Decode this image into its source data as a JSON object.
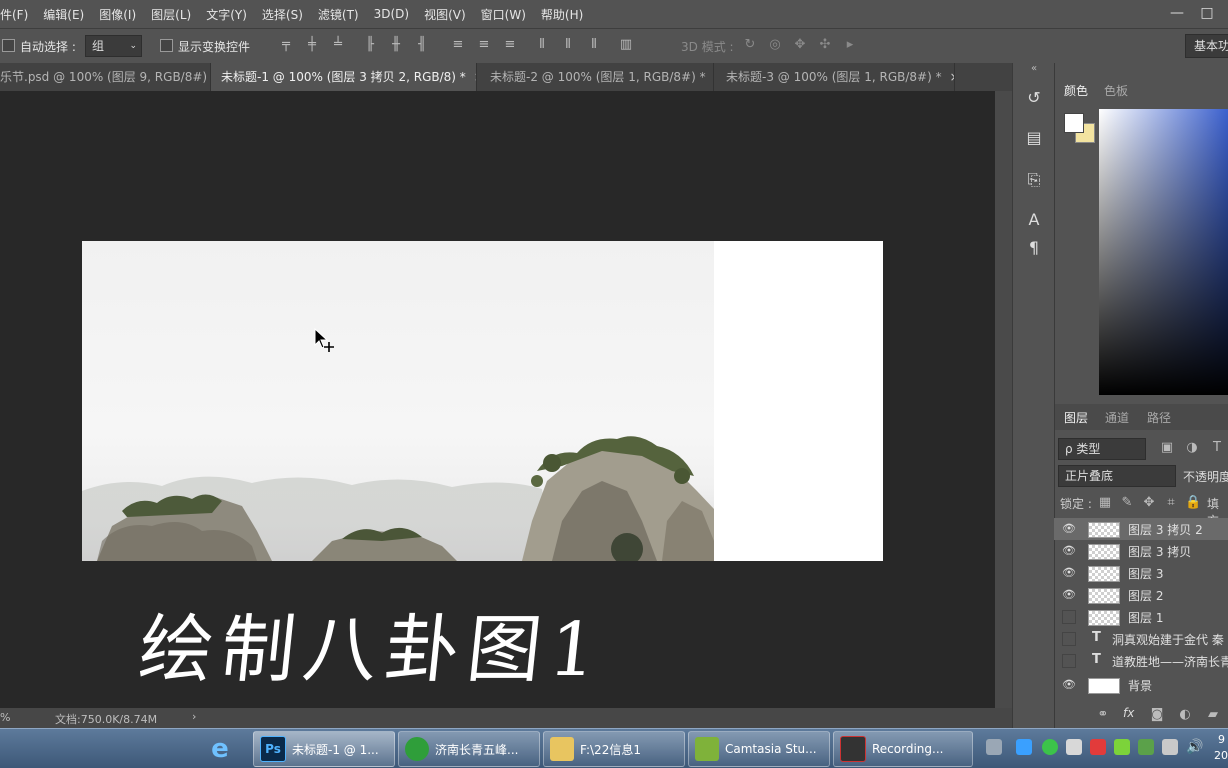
{
  "menu": [
    "件(F)",
    "编辑(E)",
    "图像(I)",
    "图层(L)",
    "文字(Y)",
    "选择(S)",
    "滤镜(T)",
    "3D(D)",
    "视图(V)",
    "窗口(W)",
    "帮助(H)"
  ],
  "window_controls": [
    "—",
    "□"
  ],
  "options": {
    "auto_select_label": "自动选择 :",
    "auto_select_value": "组",
    "show_transform_label": "显示变换控件",
    "mode3d_label": "3D 模式 :",
    "workspace": "基本功"
  },
  "tabs": [
    {
      "label": "乐节.psd @ 100% (图层 9, RGB/8#)",
      "close": "×"
    },
    {
      "label": "未标题-1 @ 100% (图层 3 拷贝 2, RGB/8) *",
      "close": "×"
    },
    {
      "label": "未标题-2 @ 100% (图层 1, RGB/8#) *",
      "close": "×"
    },
    {
      "label": "未标题-3 @ 100% (图层 1, RGB/8#) *",
      "close": "×"
    }
  ],
  "status": {
    "zoom": "%",
    "doc_info": "文档:750.0K/8.74M",
    "arrow": "›"
  },
  "caption": "绘制八卦图1",
  "color_panel": {
    "tabs": [
      "颜色",
      "色板"
    ]
  },
  "layers_panel": {
    "tabs": [
      "图层",
      "通道",
      "路径"
    ],
    "filter_kind": "ρ 类型",
    "blend_mode": "正片叠底",
    "opacity_label": "不透明度",
    "lock_label": "锁定 :",
    "fill_label": "填充",
    "layers": [
      {
        "name": "图层 3 拷贝 2",
        "kind": "pixel",
        "visible": true,
        "selected": true
      },
      {
        "name": "图层 3 拷贝",
        "kind": "pixel",
        "visible": true,
        "selected": false
      },
      {
        "name": "图层 3",
        "kind": "pixel",
        "visible": true,
        "selected": false
      },
      {
        "name": "图层 2",
        "kind": "pixel",
        "visible": true,
        "selected": false
      },
      {
        "name": "图层 1",
        "kind": "pixel",
        "visible": false,
        "selected": false
      },
      {
        "name": "洞真观始建于金代 秦",
        "kind": "text",
        "visible": false,
        "selected": false
      },
      {
        "name": "道教胜地——济南长青",
        "kind": "text",
        "visible": false,
        "selected": false
      },
      {
        "name": "背景",
        "kind": "white",
        "visible": true,
        "selected": false
      }
    ],
    "footer_fx": "fx"
  },
  "taskbar": {
    "items": [
      {
        "label": "未标题-1 @ 1...",
        "icon": "Ps"
      },
      {
        "label": "济南长青五峰...",
        "icon": "browser-icon"
      },
      {
        "label": "F:\\22信息1",
        "icon": "folder-icon"
      },
      {
        "label": "Camtasia Stu...",
        "icon": "camtasia-icon"
      },
      {
        "label": "Recording...",
        "icon": "recording-icon"
      }
    ],
    "clock_lines": [
      "9",
      "20"
    ]
  },
  "colors": {
    "foreground": "#ffffff",
    "background": "#f2e3a0",
    "accent": "#3a5fcd"
  }
}
